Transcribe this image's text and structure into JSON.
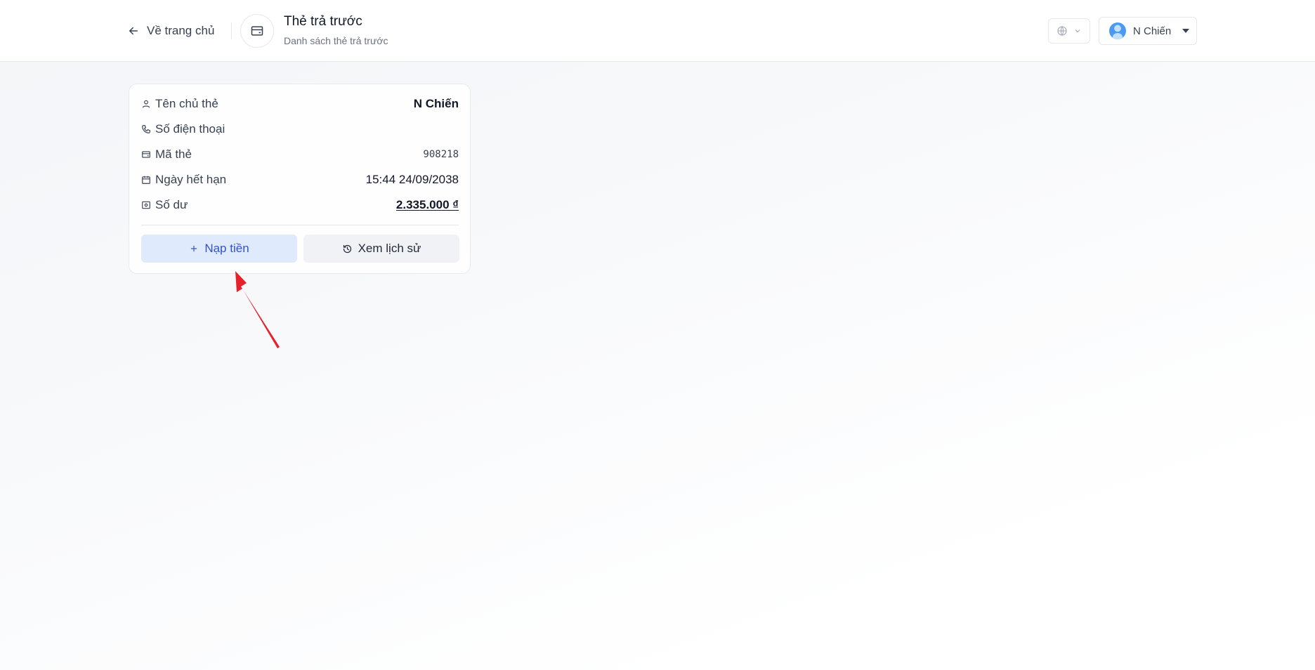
{
  "header": {
    "back_label": "Về trang chủ",
    "title": "Thẻ trả trước",
    "subtitle": "Danh sách thẻ trả trước",
    "user_name": "N Chiến"
  },
  "card": {
    "rows": [
      {
        "label": "Tên chủ thẻ",
        "value": "N Chiến",
        "icon": "user-icon"
      },
      {
        "label": "Số điện thoại",
        "value": "",
        "icon": "phone-icon"
      },
      {
        "label": "Mã thẻ",
        "value": "908218",
        "icon": "card-icon"
      },
      {
        "label": "Ngày hết hạn",
        "value": "15:44 24/09/2038",
        "icon": "calendar-icon"
      },
      {
        "label": "Số dư",
        "value": "2.335.000 ₫",
        "icon": "wallet-icon"
      }
    ],
    "topup_label": "Nạp tiền",
    "history_label": "Xem lịch sử"
  },
  "colors": {
    "accent": "#2f54c8",
    "accent_bg": "#e0eafd",
    "annotation_arrow": "#e8202a"
  }
}
